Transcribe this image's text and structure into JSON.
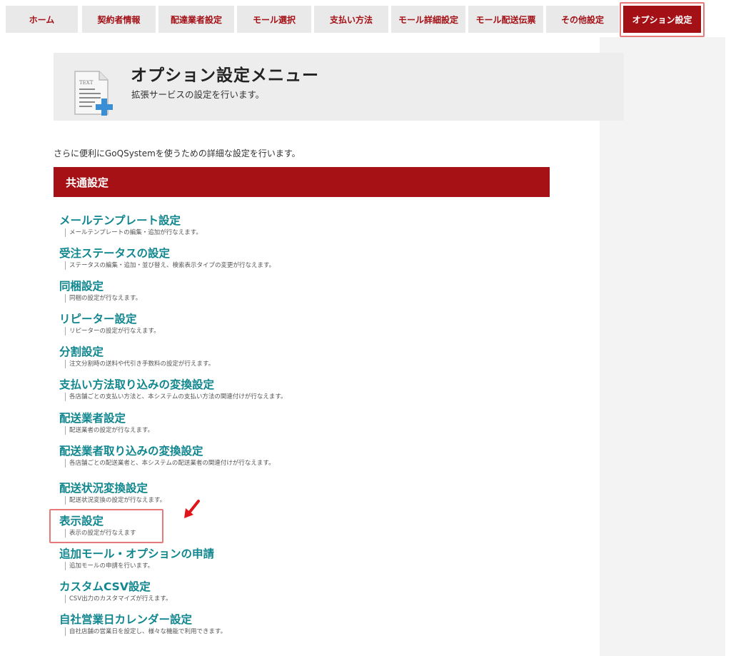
{
  "nav": {
    "tabs": [
      {
        "label": "ホーム"
      },
      {
        "label": "契約者情報"
      },
      {
        "label": "配達業者設定"
      },
      {
        "label": "モール選択"
      },
      {
        "label": "支払い方法"
      },
      {
        "label": "モール詳細設定"
      },
      {
        "label": "モール配送伝票"
      },
      {
        "label": "その他設定"
      },
      {
        "label": "オプション設定",
        "active": true
      }
    ]
  },
  "header": {
    "icon_text": "TEXT",
    "title": "オプション設定メニュー",
    "subtitle": "拡張サービスの設定を行います。"
  },
  "intro": "さらに便利にGoQSystemを使うための詳細な設定を行います。",
  "section": {
    "title": "共通設定"
  },
  "menu": [
    {
      "title": "メールテンプレート設定",
      "desc": "メールテンプレートの編集・追加が行なえます。"
    },
    {
      "title": "受注ステータスの設定",
      "desc": "ステータスの編集・追加・並び替え、検索表示タイプの変更が行なえます。"
    },
    {
      "title": "同梱設定",
      "desc": "同梱の設定が行なえます。"
    },
    {
      "title": "リピーター設定",
      "desc": "リピーターの設定が行なえます。"
    },
    {
      "title": "分割設定",
      "desc": "注文分割時の送料や代引き手数料の設定が行えます。"
    },
    {
      "title": "支払い方法取り込みの変換設定",
      "desc": "各店舗ごとの支払い方法と、本システムの支払い方法の関連付けが行なえます。"
    },
    {
      "title": "配送業者設定",
      "desc": "配送業者の設定が行なえます。"
    },
    {
      "title": "配送業者取り込みの変換設定",
      "desc": "各店舗ごとの配送業者と、本システムの配送業者の関連付けが行なえます。"
    },
    {
      "title": "配送状況変換設定",
      "desc": "配送状況変換の設定が行なえます。"
    },
    {
      "title": "表示設定",
      "desc": "表示の設定が行なえます"
    },
    {
      "title": "追加モール・オプションの申請",
      "desc": "追加モールの申請を行います。"
    },
    {
      "title": "カスタムCSV設定",
      "desc": "CSV出力のカスタマイズが行えます。"
    },
    {
      "title": "自社営業日カレンダー設定",
      "desc": "自社店舗の営業日を設定し、様々な機能で利用できます。"
    }
  ],
  "colors": {
    "accent": "#a61115",
    "link": "#10868e",
    "highlight": "#e87979"
  }
}
